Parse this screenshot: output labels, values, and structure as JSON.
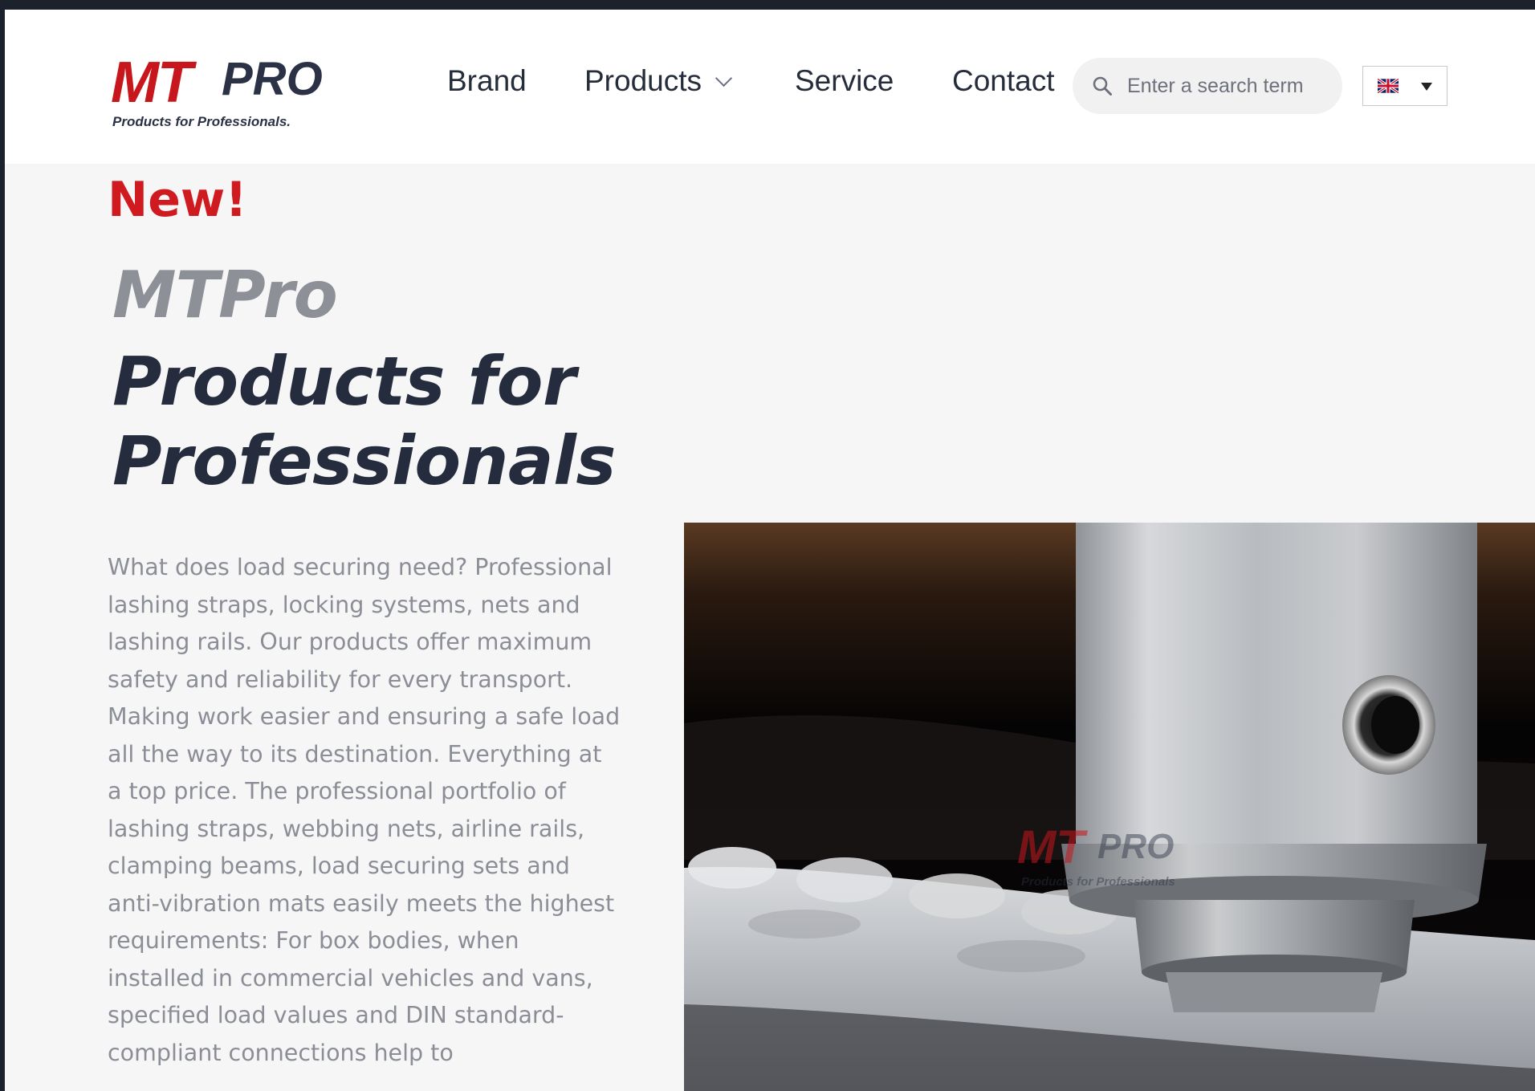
{
  "header": {
    "logo": {
      "mark": "MT",
      "name": "PRO",
      "tagline": "Products for Professionals."
    },
    "nav": [
      {
        "label": "Brand"
      },
      {
        "label": "Products",
        "has_dropdown": true
      },
      {
        "label": "Service"
      },
      {
        "label": "Contact"
      }
    ],
    "search": {
      "placeholder": "Enter a search term",
      "icon": "search-icon"
    },
    "language": {
      "flag": "uk-flag-icon",
      "icon": "caret-down-icon"
    }
  },
  "hero": {
    "badge": "New!",
    "brand_title": "MTPro",
    "headline": "Products for Professionals",
    "body": "What does load securing need? Professional lashing straps, locking systems, nets and lashing rails. Our products offer maximum safety and reliability for every transport. Making work easier and ensuring a safe load all the way to its destination. Everything at a top price. The professional portfolio of lashing straps, webbing nets, airline rails, clamping beams, load securing sets and anti-vibration mats easily meets the highest requirements: For box bodies, when installed in commercial vehicles and vans, specified load values and DIN standard-compliant connections help to",
    "image_watermark": {
      "mark": "MT",
      "name": "PRO",
      "tagline": "Products for Professionals"
    }
  },
  "colors": {
    "accent_red": "#cf1a1f",
    "heading_dark": "#252c3d",
    "brand_gray": "#8e9098",
    "body_gray": "#8b8e96",
    "hero_bg": "#f6f6f6"
  }
}
